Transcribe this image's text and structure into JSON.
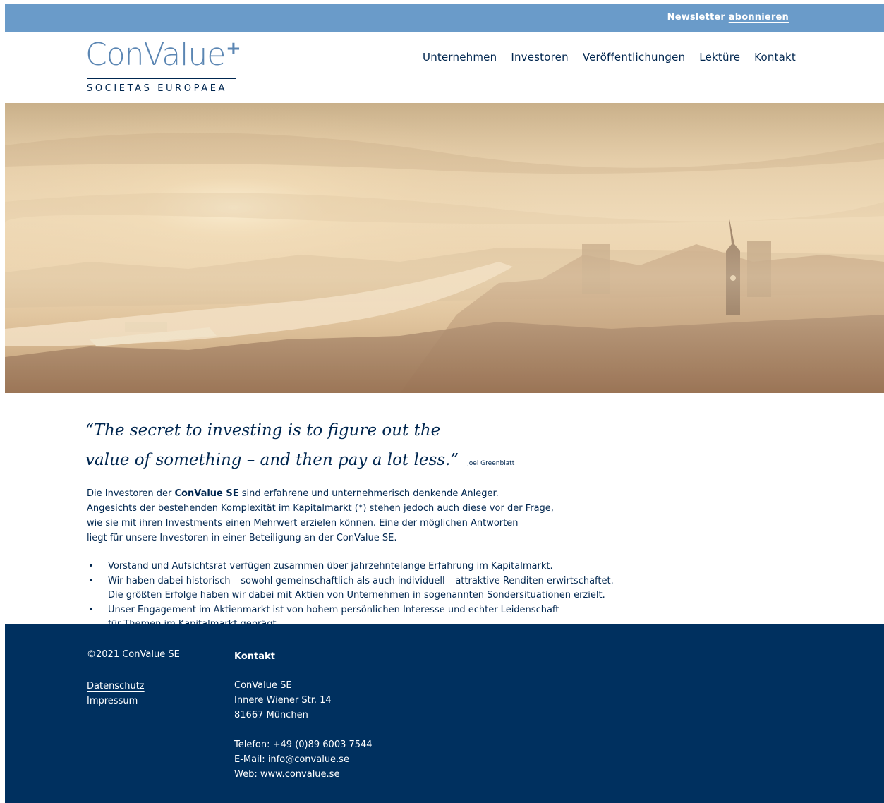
{
  "topbar": {
    "newsletter_label": "Newsletter",
    "newsletter_link": "abonnieren"
  },
  "logo": {
    "name": "ConValue",
    "plus": "+",
    "subtitle": "SOCIETAS EUROPAEA"
  },
  "nav": {
    "items": [
      {
        "label": "Unternehmen"
      },
      {
        "label": "Investoren"
      },
      {
        "label": "Veröffentlichungen"
      },
      {
        "label": "Lektüre"
      },
      {
        "label": "Kontakt"
      }
    ]
  },
  "quote": {
    "line1": "“The secret to investing is to figure out the",
    "line2": "value of something – and then pay a lot less.”",
    "author": "Joel Greenblatt"
  },
  "intro": {
    "line1_pre": "Die Investoren der ",
    "line1_bold": "ConValue SE",
    "line1_post": " sind erfahrene und unternehmerisch denkende Anleger.",
    "line2": "Angesichts der bestehenden Komplexität im Kapitalmarkt (*) stehen jedoch auch diese vor der Frage,",
    "line3": "wie sie mit ihren Investments einen Mehrwert erzielen können. Eine der möglichen Antworten",
    "line4": "liegt für unsere Investoren in einer Beteiligung an der ConValue SE."
  },
  "bullets": {
    "b1": "Vorstand und Aufsichtsrat verfügen zusammen über jahrzehntelange Erfahrung im Kapitalmarkt.",
    "b2_line1": "Wir haben dabei historisch – sowohl gemeinschaftlich als auch individuell – attraktive Renditen erwirtschaftet.",
    "b2_line2": "Die größten Erfolge haben wir dabei mit Aktien von Unternehmen in sogenannten Sondersituationen erzielt.",
    "b3_line1": "Unser Engagement im Aktienmarkt ist von hohem persönlichen Interesse und echter Leidenschaft",
    "b3_line2": "für Themen im Kapitalmarkt geprägt."
  },
  "footer": {
    "copyright": "©2021 ConValue SE",
    "datenschutz": "Datenschutz",
    "impressum": "Impressum",
    "kontakt_heading": "Kontakt",
    "company": "ConValue SE",
    "street": "Innere Wiener Str. 14",
    "city": "81667 München",
    "phone": "Telefon: +49 (0)89 6003 7544",
    "email": "E-Mail: info@convalue.se",
    "web": "Web: www.convalue.se"
  },
  "colors": {
    "topbar": "#6a9bc9",
    "navy": "#00264f",
    "footer": "#00305f",
    "logo_blue": "#5b86b3"
  }
}
